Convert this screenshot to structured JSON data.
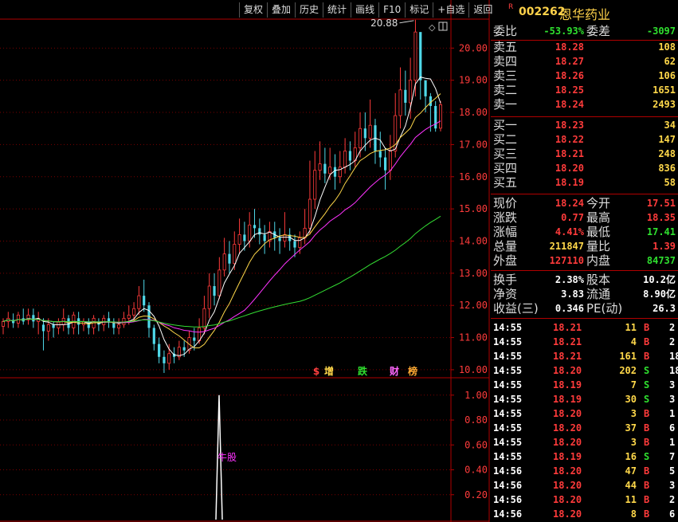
{
  "toolbar": [
    "复权",
    "叠加",
    "历史",
    "统计",
    "画线",
    "F10",
    "标记",
    "+自选",
    "返回"
  ],
  "stock": {
    "marker": "R",
    "code": "002262",
    "name": "恩华药业"
  },
  "commission": {
    "ratio_label": "委比",
    "ratio": "-53.93%",
    "diff_label": "委差",
    "diff": "-3097"
  },
  "asks": [
    {
      "label": "卖五",
      "price": "18.28",
      "vol": "108"
    },
    {
      "label": "卖四",
      "price": "18.27",
      "vol": "62"
    },
    {
      "label": "卖三",
      "price": "18.26",
      "vol": "106"
    },
    {
      "label": "卖二",
      "price": "18.25",
      "vol": "1651"
    },
    {
      "label": "卖一",
      "price": "18.24",
      "vol": "2493"
    }
  ],
  "bids": [
    {
      "label": "买一",
      "price": "18.23",
      "vol": "34"
    },
    {
      "label": "买二",
      "price": "18.22",
      "vol": "147"
    },
    {
      "label": "买三",
      "price": "18.21",
      "vol": "248"
    },
    {
      "label": "买四",
      "price": "18.20",
      "vol": "836"
    },
    {
      "label": "买五",
      "price": "18.19",
      "vol": "58"
    }
  ],
  "stats": [
    {
      "l1": "现价",
      "v1": "18.24",
      "c1": "red",
      "l2": "今开",
      "v2": "17.51",
      "c2": "red"
    },
    {
      "l1": "涨跌",
      "v1": "0.77",
      "c1": "red",
      "l2": "最高",
      "v2": "18.35",
      "c2": "red"
    },
    {
      "l1": "涨幅",
      "v1": "4.41%",
      "c1": "red",
      "l2": "最低",
      "v2": "17.41",
      "c2": "grn"
    },
    {
      "l1": "总量",
      "v1": "211847",
      "c1": "yel",
      "l2": "量比",
      "v2": "1.39",
      "c2": "red"
    },
    {
      "l1": "外盘",
      "v1": "127110",
      "c1": "red",
      "l2": "内盘",
      "v2": "84737",
      "c2": "grn"
    }
  ],
  "fundamentals": [
    {
      "l1": "换手",
      "v1": "2.38%",
      "l2": "股本",
      "v2": "10.2亿"
    },
    {
      "l1": "净资",
      "v1": "3.83",
      "l2": "流通",
      "v2": "8.90亿"
    },
    {
      "l1": "收益(三)",
      "v1": "0.346",
      "l2": "PE(动)",
      "v2": "26.3"
    }
  ],
  "ticks": [
    {
      "t": "14:55",
      "p": "18.21",
      "v": "11",
      "s": "B",
      "n": "2"
    },
    {
      "t": "14:55",
      "p": "18.21",
      "v": "4",
      "s": "B",
      "n": "2"
    },
    {
      "t": "14:55",
      "p": "18.21",
      "v": "161",
      "s": "B",
      "n": "18"
    },
    {
      "t": "14:55",
      "p": "18.20",
      "v": "202",
      "s": "S",
      "n": "18"
    },
    {
      "t": "14:55",
      "p": "18.19",
      "v": "7",
      "s": "S",
      "n": "3"
    },
    {
      "t": "14:55",
      "p": "18.19",
      "v": "30",
      "s": "S",
      "n": "3"
    },
    {
      "t": "14:55",
      "p": "18.20",
      "v": "3",
      "s": "B",
      "n": "1"
    },
    {
      "t": "14:55",
      "p": "18.20",
      "v": "37",
      "s": "B",
      "n": "6"
    },
    {
      "t": "14:55",
      "p": "18.20",
      "v": "3",
      "s": "B",
      "n": "1"
    },
    {
      "t": "14:55",
      "p": "18.19",
      "v": "16",
      "s": "S",
      "n": "7"
    },
    {
      "t": "14:56",
      "p": "18.20",
      "v": "47",
      "s": "B",
      "n": "5"
    },
    {
      "t": "14:56",
      "p": "18.20",
      "v": "44",
      "s": "B",
      "n": "3"
    },
    {
      "t": "14:56",
      "p": "18.20",
      "v": "11",
      "s": "B",
      "n": "2"
    },
    {
      "t": "14:56",
      "p": "18.20",
      "v": "8",
      "s": "B",
      "n": "6"
    }
  ],
  "chart_data": {
    "type": "candlestick",
    "price_axis": {
      "ticks": [
        "20.00",
        "19.00",
        "18.00",
        "17.00",
        "16.00",
        "15.00",
        "14.00",
        "13.00",
        "12.00",
        "11.00",
        "10.00"
      ],
      "ylim": [
        9.8,
        20.9
      ]
    },
    "peak_annotation": "20.88",
    "marker_labels": [
      "$",
      "增",
      "跌",
      "财",
      "榜"
    ],
    "marker_colors": [
      "#ff4040",
      "#ffd84a",
      "#2fe02f",
      "#ff66ff",
      "#ffaa33"
    ],
    "candles": [
      [
        11.35,
        11.5,
        11.1,
        11.6
      ],
      [
        11.5,
        11.6,
        11.3,
        11.8
      ],
      [
        11.55,
        11.45,
        11.3,
        11.75
      ],
      [
        11.45,
        11.7,
        11.3,
        11.8
      ],
      [
        11.6,
        11.5,
        11.4,
        11.9
      ],
      [
        11.55,
        11.7,
        11.4,
        11.9
      ],
      [
        11.7,
        11.5,
        11.3,
        11.9
      ],
      [
        11.5,
        11.6,
        11.1,
        11.8
      ],
      [
        11.4,
        11.2,
        10.6,
        11.6
      ],
      [
        11.2,
        11.4,
        10.9,
        11.6
      ],
      [
        11.4,
        11.3,
        11.0,
        11.5
      ],
      [
        11.3,
        11.5,
        11.1,
        11.6
      ],
      [
        11.4,
        11.6,
        11.2,
        11.9
      ],
      [
        11.6,
        11.3,
        11.1,
        11.7
      ],
      [
        11.3,
        11.7,
        11.1,
        11.8
      ],
      [
        11.6,
        11.4,
        11.1,
        11.8
      ],
      [
        11.4,
        11.5,
        11.2,
        11.6
      ],
      [
        11.5,
        11.3,
        11.1,
        11.6
      ],
      [
        11.3,
        11.6,
        11.1,
        11.7
      ],
      [
        11.5,
        11.4,
        11.2,
        11.6
      ],
      [
        11.4,
        11.6,
        11.2,
        11.7
      ],
      [
        11.6,
        11.5,
        11.3,
        11.8
      ],
      [
        11.5,
        11.3,
        11.1,
        11.6
      ],
      [
        11.3,
        11.4,
        11.1,
        11.6
      ],
      [
        11.4,
        11.6,
        11.3,
        11.8
      ],
      [
        11.6,
        11.7,
        11.4,
        12.0
      ],
      [
        11.7,
        11.9,
        11.5,
        12.1
      ],
      [
        11.9,
        12.3,
        11.7,
        12.6
      ],
      [
        12.3,
        12.0,
        11.8,
        12.8
      ],
      [
        12.0,
        11.3,
        11.0,
        12.1
      ],
      [
        11.3,
        10.8,
        10.6,
        11.4
      ],
      [
        10.8,
        10.4,
        10.2,
        11.0
      ],
      [
        10.4,
        10.2,
        9.9,
        10.6
      ],
      [
        10.2,
        10.5,
        10.0,
        10.8
      ],
      [
        10.5,
        10.4,
        10.2,
        10.7
      ],
      [
        10.4,
        10.7,
        10.3,
        10.9
      ],
      [
        10.7,
        10.6,
        10.4,
        10.9
      ],
      [
        10.6,
        11.0,
        10.5,
        11.2
      ],
      [
        11.0,
        10.9,
        10.6,
        11.3
      ],
      [
        10.9,
        11.3,
        10.8,
        11.6
      ],
      [
        11.3,
        11.9,
        11.1,
        12.3
      ],
      [
        11.9,
        12.6,
        11.6,
        13.0
      ],
      [
        12.6,
        12.3,
        12.0,
        13.0
      ],
      [
        12.3,
        13.1,
        12.2,
        13.5
      ],
      [
        13.1,
        13.6,
        12.9,
        14.1
      ],
      [
        13.6,
        13.3,
        13.0,
        14.0
      ],
      [
        13.3,
        13.9,
        13.1,
        14.3
      ],
      [
        13.9,
        14.2,
        13.6,
        14.7
      ],
      [
        14.2,
        14.0,
        13.7,
        14.6
      ],
      [
        14.0,
        14.5,
        13.8,
        14.9
      ],
      [
        14.5,
        14.4,
        14.1,
        15.0
      ],
      [
        14.4,
        14.2,
        13.9,
        14.7
      ],
      [
        14.2,
        14.0,
        13.6,
        14.5
      ],
      [
        14.0,
        14.3,
        13.8,
        14.6
      ],
      [
        14.3,
        14.1,
        13.7,
        14.6
      ],
      [
        14.1,
        14.0,
        13.6,
        14.4
      ],
      [
        14.0,
        14.2,
        13.8,
        14.9
      ],
      [
        14.2,
        14.0,
        13.7,
        14.4
      ],
      [
        14.0,
        13.8,
        13.5,
        14.2
      ],
      [
        13.8,
        14.1,
        13.6,
        14.3
      ],
      [
        14.1,
        14.4,
        13.9,
        15.0
      ],
      [
        14.4,
        15.3,
        14.2,
        16.5
      ],
      [
        15.3,
        16.2,
        15.0,
        16.8
      ],
      [
        16.2,
        16.4,
        15.9,
        17.1
      ],
      [
        16.4,
        16.1,
        15.8,
        16.9
      ],
      [
        16.1,
        16.3,
        15.9,
        16.9
      ],
      [
        16.3,
        16.0,
        15.6,
        16.7
      ],
      [
        16.0,
        16.3,
        15.8,
        16.8
      ],
      [
        16.3,
        16.8,
        16.1,
        17.2
      ],
      [
        16.8,
        16.5,
        16.2,
        17.1
      ],
      [
        16.5,
        16.9,
        16.3,
        17.4
      ],
      [
        16.9,
        17.5,
        16.6,
        18.0
      ],
      [
        17.5,
        17.2,
        16.8,
        18.0
      ],
      [
        17.2,
        17.6,
        16.9,
        18.4
      ],
      [
        17.6,
        16.8,
        16.4,
        17.8
      ],
      [
        16.8,
        16.6,
        16.3,
        17.4
      ],
      [
        16.6,
        16.2,
        15.6,
        16.9
      ],
      [
        16.2,
        16.8,
        15.9,
        17.3
      ],
      [
        16.8,
        17.9,
        16.6,
        18.6
      ],
      [
        17.9,
        18.7,
        17.5,
        19.4
      ],
      [
        18.7,
        18.3,
        17.9,
        19.3
      ],
      [
        18.3,
        19.0,
        17.8,
        19.7
      ],
      [
        19.0,
        20.5,
        18.5,
        20.88
      ],
      [
        20.5,
        19.0,
        18.4,
        20.4
      ],
      [
        19.0,
        18.5,
        18.0,
        19.0
      ],
      [
        18.5,
        18.2,
        17.4,
        18.6
      ],
      [
        18.2,
        17.5,
        17.4,
        18.35
      ],
      [
        17.51,
        18.24,
        17.41,
        18.35
      ]
    ],
    "volume_axis": {
      "ticks": [
        "1.00",
        "0.80",
        "0.60",
        "0.40",
        "0.20"
      ],
      "ylim": [
        0,
        1.05
      ]
    },
    "signal_label": "牛股",
    "signal_value": 1.0
  }
}
